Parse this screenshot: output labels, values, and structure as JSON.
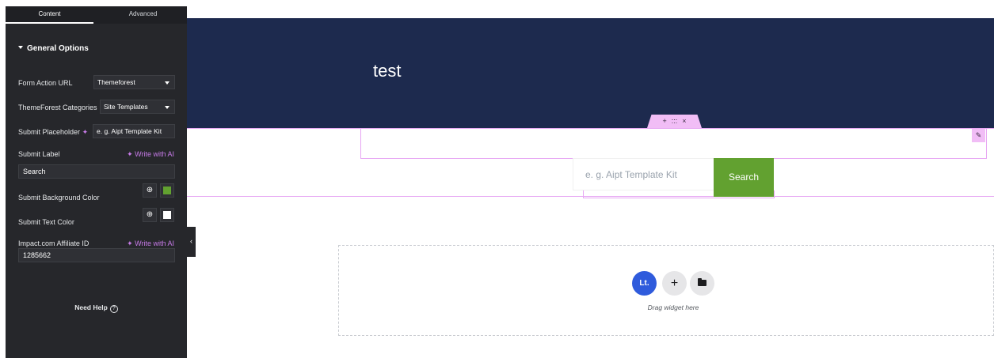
{
  "panel": {
    "tabs": [
      "Content",
      "Advanced"
    ],
    "section_title": "General Options",
    "fields": {
      "form_action_url": {
        "label": "Form Action URL",
        "value": "Themeforest"
      },
      "themeforest_categories": {
        "label": "ThemeForest Categories",
        "value": "Site Templates"
      },
      "submit_placeholder": {
        "label": "Submit Placeholder",
        "value": "e. g. Aipt Template Kit"
      },
      "submit_label": {
        "label": "Submit Label",
        "write_ai": "Write with AI",
        "value": "Search"
      },
      "submit_bg_color": {
        "label": "Submit Background Color",
        "color": "#62a130"
      },
      "submit_text_color": {
        "label": "Submit Text Color",
        "color": "#ffffff"
      },
      "affiliate_id": {
        "label": "Impact.com Affiliate ID",
        "write_ai": "Write with AI",
        "value": "1285662"
      }
    },
    "help": "Need Help"
  },
  "canvas": {
    "hero_title": "test",
    "search_placeholder": "e. g. Aipt Template Kit",
    "search_button": "Search",
    "toolbar_icons": [
      "+",
      ":::",
      "×"
    ],
    "drop_zone": {
      "lt": "Lt.",
      "drag_text": "Drag widget here"
    }
  },
  "colors": {
    "panel_bg": "#26272b",
    "hero_bg": "#1d2a4e",
    "accent_pink": "#e7a6f3",
    "search_button_bg": "#62a130",
    "lt_blue": "#2f5bdc"
  },
  "icons": {
    "spark": "sparkle-icon",
    "globe": "globe-icon",
    "help": "question-circle-icon",
    "edit": "pencil-icon",
    "collapse": "chevron-left-icon",
    "folder": "folder-icon"
  }
}
